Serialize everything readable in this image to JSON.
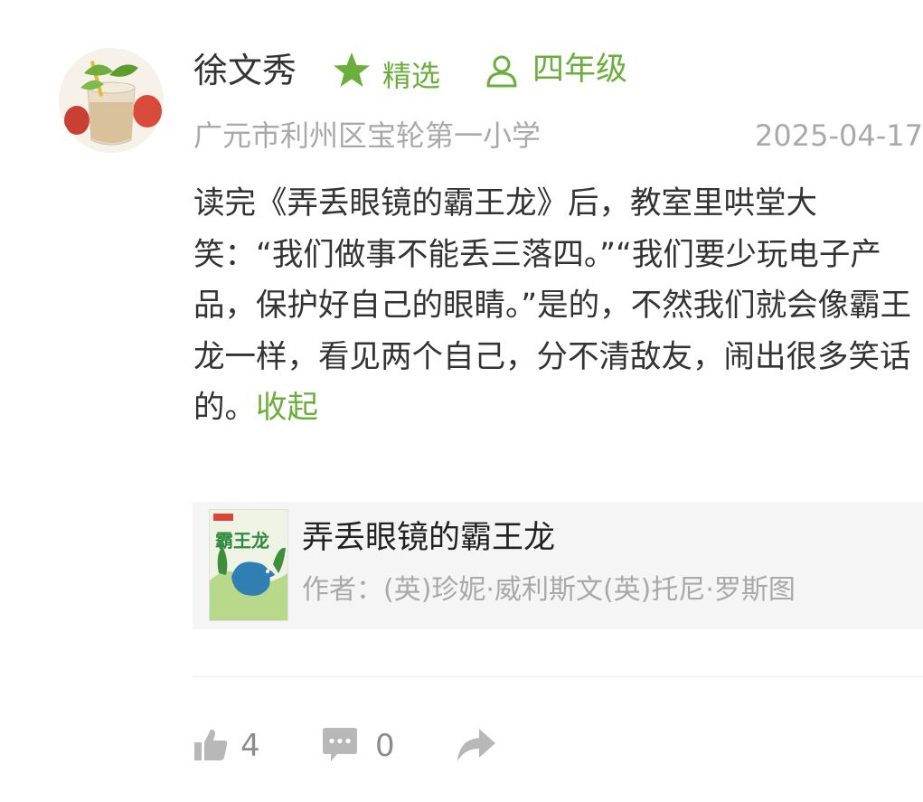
{
  "post": {
    "author": "徐文秀",
    "featured_label": "精选",
    "grade_label": "四年级",
    "school": "广元市利州区宝轮第一小学",
    "date": "2025-04-17",
    "text": "读完《弄丢眼镜的霸王龙》后，教室里哄堂大笑：“我们做事不能丢三落四。”“我们要少玩电子产品，保护好自己的眼睛。”是的，不然我们就会像霸王龙一样，看见两个自己，分不清敌友，闹出很多笑话的。",
    "collapse_label": "收起"
  },
  "book": {
    "title": "弄丢眼镜的霸王龙",
    "author": "作者：(英)珍妮·威利斯文(英)托尼·罗斯图",
    "cover_text": "霸王龙"
  },
  "actions": {
    "like_count": "4",
    "comment_count": "0"
  },
  "colors": {
    "accent": "#6bae3c",
    "muted": "#a9a9a9",
    "icon_gray": "#b8b8b8"
  }
}
